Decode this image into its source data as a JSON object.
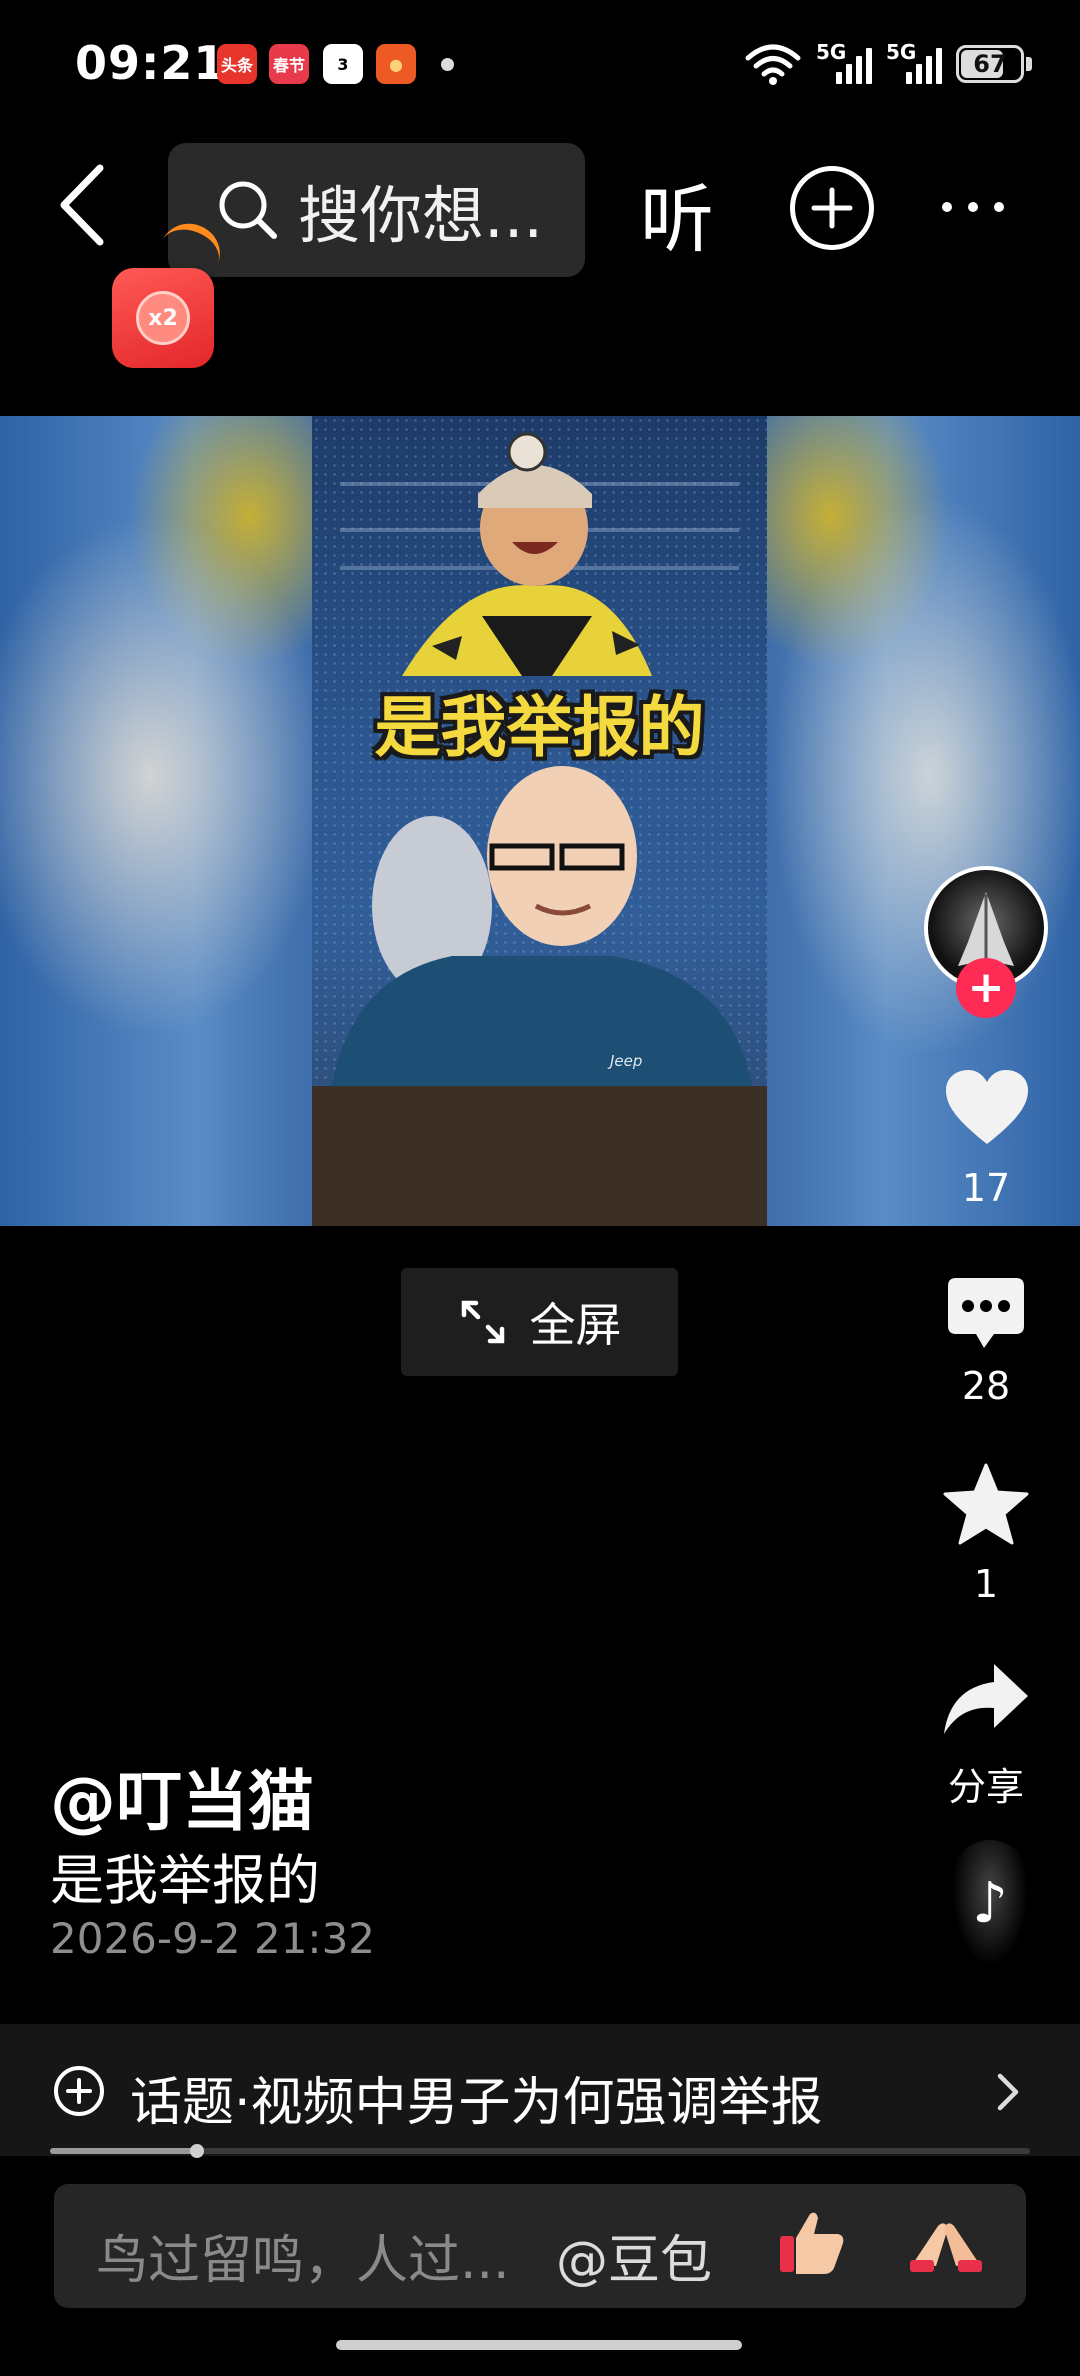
{
  "status_bar": {
    "time": "09:21",
    "apps": [
      {
        "label": "头条",
        "bg": "#e8352c",
        "fg": "#ffffff"
      },
      {
        "label": "春节",
        "bg": "#e83a4a",
        "fg": "#ffffff"
      },
      {
        "label": "3",
        "bg": "#ffffff",
        "fg": "#000000"
      },
      {
        "label": "●",
        "bg": "#ee5a24",
        "fg": "#ffd27a"
      }
    ],
    "network_1": "5G",
    "network_2": "5G",
    "battery": "67"
  },
  "top_nav": {
    "search_placeholder": "搜你想...",
    "listen_label": "听"
  },
  "red_packet": {
    "multiplier": "x2"
  },
  "video": {
    "caption": "是我举报的",
    "shirt_text": "Jeep",
    "fullscreen_label": "全屏"
  },
  "rail": {
    "likes": "17",
    "comments": "28",
    "favorites": "1",
    "share_label": "分享"
  },
  "post": {
    "author": "@叮当猫",
    "description": "是我举报的",
    "date": "2026-9-2 21:32"
  },
  "topic": {
    "text": "话题·视频中男子为何强调举报",
    "progress_fraction": 0.15
  },
  "comment_input": {
    "placeholder": "鸟过留鸣，人过...",
    "mention": "@豆包"
  },
  "colors": {
    "accent_red": "#fe2c55",
    "caption_yellow": "#f4d93f"
  }
}
